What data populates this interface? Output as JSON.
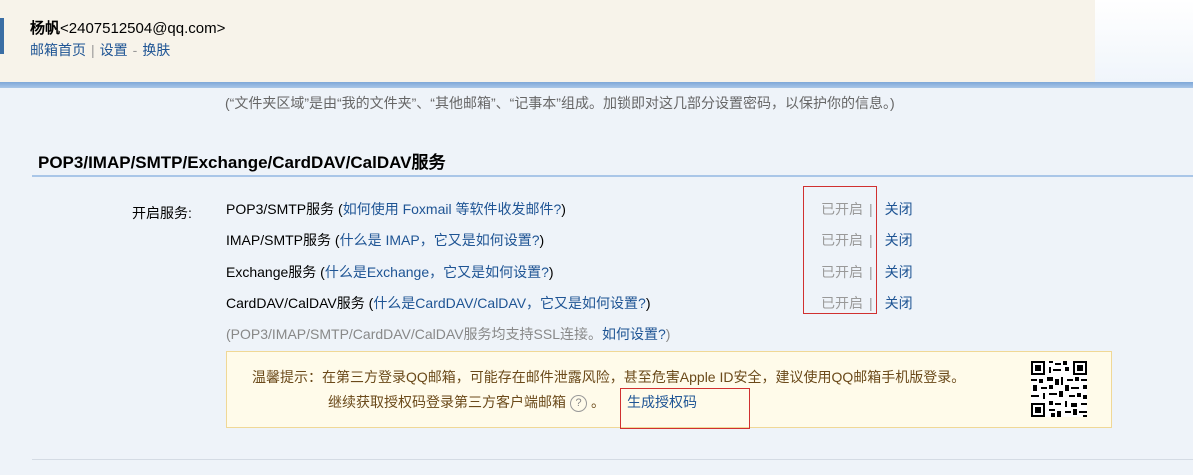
{
  "header": {
    "user_name": "杨帆",
    "user_email": "<2407512504@qq.com>",
    "links": [
      "邮箱首页",
      "设置",
      "换肤"
    ],
    "link_separators": [
      "|",
      "-"
    ]
  },
  "folder_note": "(“文件夹区域”是由“我的文件夹”、“其他邮箱”、“记事本”组成。加锁即对这几部分设置密码，以保护你的信息。)",
  "section": {
    "title": "POP3/IMAP/SMTP/Exchange/CardDAV/CalDAV服务",
    "label": "开启服务:"
  },
  "services": [
    {
      "name": "POP3/SMTP服务",
      "open": "(",
      "question": "如何使用 Foxmail 等软件收发邮件?",
      "close": ")",
      "status": "已开启",
      "sep": "|",
      "action": "关闭"
    },
    {
      "name": "IMAP/SMTP服务",
      "open": "(",
      "question": "什么是 IMAP，它又是如何设置?",
      "close": ")",
      "status": "已开启",
      "sep": "|",
      "action": "关闭"
    },
    {
      "name": "Exchange服务",
      "open": "(",
      "question": "什么是Exchange，它又是如何设置?",
      "close": ")",
      "status": "已开启",
      "sep": "|",
      "action": "关闭"
    },
    {
      "name": "CardDAV/CalDAV服务",
      "open": "(",
      "question": "什么是CardDAV/CalDAV，它又是如何设置?",
      "close": ")",
      "status": "已开启",
      "sep": "|",
      "action": "关闭"
    }
  ],
  "ssl_note": {
    "text": "(POP3/IMAP/SMTP/CardDAV/CalDAV服务均支持SSL连接。",
    "link": "如何设置?",
    "close": ")"
  },
  "tip": {
    "line1": "温馨提示：在第三方登录QQ邮箱，可能存在邮件泄露风险，甚至危害Apple ID安全，建议使用QQ邮箱手机版登录。",
    "line2": "继续获取授权码登录第三方客户端邮箱",
    "help_glyph": "?",
    "period": "。",
    "generate_link": "生成授权码"
  },
  "colors": {
    "link": "#1e5494",
    "highlight_box": "#d03030",
    "tip_bg": "#fffbea"
  }
}
